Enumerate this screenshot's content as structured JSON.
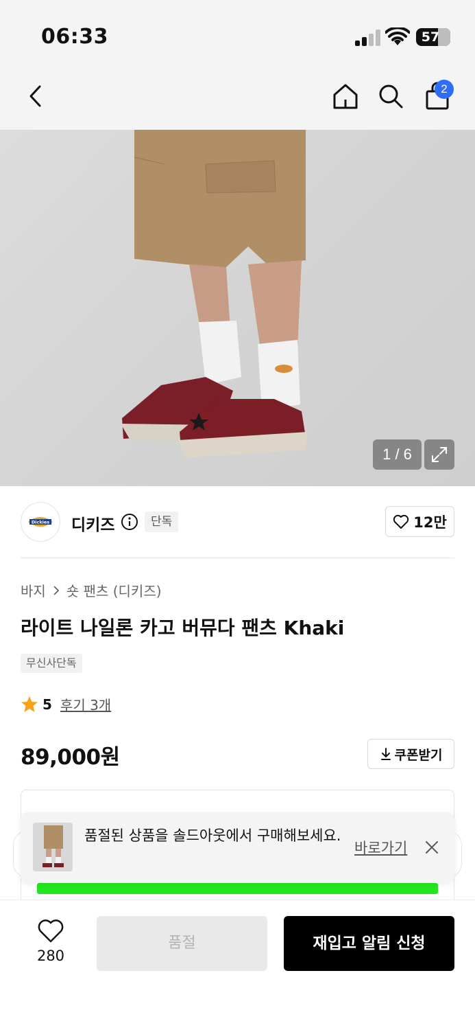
{
  "status_bar": {
    "time": "06:33",
    "battery": "57"
  },
  "nav": {
    "cart_count": "2"
  },
  "gallery": {
    "counter": "1 / 6"
  },
  "brand": {
    "name": "디키즈",
    "tag": "단독",
    "likes": "12만",
    "logo_text": "Dickies"
  },
  "product": {
    "breadcrumb": [
      "바지",
      "숏 팬츠 (디키즈)"
    ],
    "title": "라이트 나일론 카고 버뮤다 팬츠 Khaki",
    "tag": "무신사단독",
    "rating": "5",
    "reviews": "후기 3개",
    "price": "89,000원",
    "coupon_label": "쿠폰받기"
  },
  "toast": {
    "message": "품절된 상품을 솔드아웃에서 구매해보세요.",
    "link": "바로가기"
  },
  "bottom": {
    "wish_count": "280",
    "soldout_label": "품절",
    "restock_label": "재입고 알림 신청"
  },
  "colors": {
    "accent": "#2f6df6",
    "price_red": "#e8262d",
    "star": "#f7a21b",
    "green_bar": "#22e61f"
  }
}
